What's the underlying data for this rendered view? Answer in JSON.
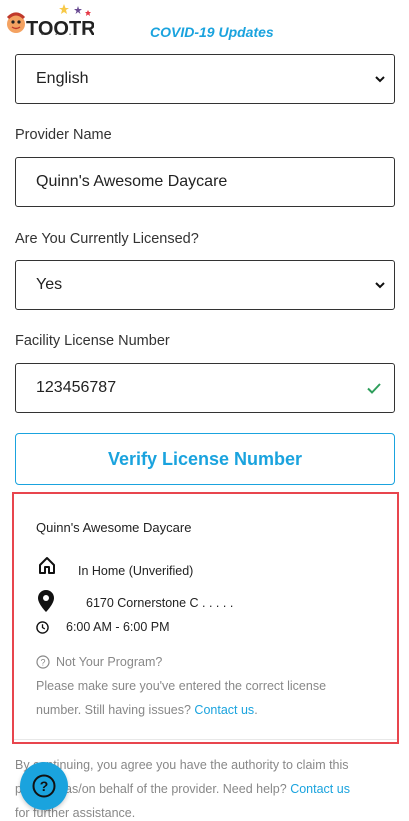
{
  "header": {
    "brand": "TOOTRIS",
    "covid_link": "COVID-19 Updates",
    "brand_colors": [
      "#e63946",
      "#2a9d8f",
      "#1aa3de",
      "#f4a261",
      "#6a4c93"
    ]
  },
  "form": {
    "language": {
      "value": "English"
    },
    "provider_name": {
      "label": "Provider Name",
      "value": "Quinn's Awesome Daycare"
    },
    "licensed": {
      "label": "Are You Currently Licensed?",
      "value": "Yes"
    },
    "license_number": {
      "label": "Facility License Number",
      "value": "123456787"
    },
    "verify_label": "Verify License Number"
  },
  "result": {
    "name": "Quinn's Awesome Daycare",
    "type": "In Home (Unverified)",
    "address": "6170 Cornerstone C . . . . .",
    "hours": "6:00 AM - 6:00 PM",
    "not_your_program": "Not Your Program?",
    "help_line1": "Please make sure you've entered the correct license",
    "help_line2": "number. Still having issues? ",
    "contact_label": "Contact us",
    "help_line2_end": "."
  },
  "disclaimer": {
    "line1": "By continuing, you agree you have the authority to claim this",
    "line2": "program as/on behalf of the provider. Need help? ",
    "contact_label": "Contact us",
    "line3": "for further assistance."
  },
  "colors": {
    "accent": "#1aa3de",
    "highlight": "#e8454d",
    "success": "#2e9e5b"
  }
}
